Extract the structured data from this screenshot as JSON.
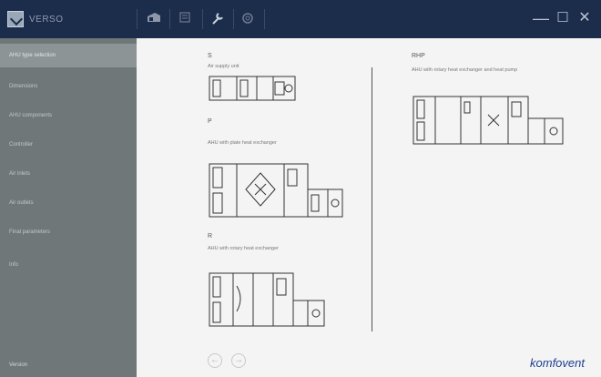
{
  "app": {
    "brand": "VERSO"
  },
  "toolbar": {
    "icons": [
      "ahu-unit-icon",
      "list-icon",
      "wrench-icon",
      "gear-icon"
    ]
  },
  "window": {
    "minimize": "—",
    "maximize": "☐",
    "close": "✕"
  },
  "sidebar": {
    "items": [
      {
        "label": "AHU type selection",
        "active": true
      },
      {
        "label": "Dimensions"
      },
      {
        "label": "AHU components"
      },
      {
        "label": "Controller"
      },
      {
        "label": "Air inlets"
      },
      {
        "label": "Air outlets"
      },
      {
        "label": "Final parameters"
      },
      {
        "label": "Info"
      }
    ],
    "footer": "Version"
  },
  "options": {
    "s": {
      "code": "S",
      "desc": "Air supply unit"
    },
    "p": {
      "code": "P",
      "desc": "AHU with plate heat exchanger"
    },
    "r": {
      "code": "R",
      "desc": "AHU with rotary heat exchanger"
    },
    "rhp": {
      "code": "RHP",
      "desc": "AHU with rotary heat exchanger and heat pump"
    }
  },
  "nav": {
    "prev": "←",
    "next": "→"
  },
  "footer": {
    "logo": "komfovent"
  }
}
